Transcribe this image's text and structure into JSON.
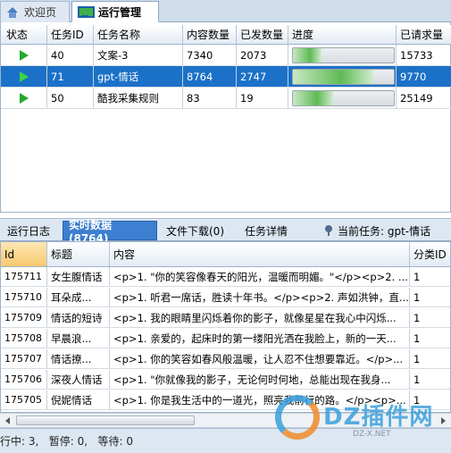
{
  "top_tabs": [
    {
      "label": "欢迎页",
      "icon": "home-icon",
      "active": false
    },
    {
      "label": "运行管理",
      "icon": "monitor-icon",
      "active": true
    }
  ],
  "task_grid": {
    "columns": [
      "状态",
      "任务ID",
      "任务名称",
      "内容数量",
      "已发数量",
      "进度",
      "已请求量"
    ],
    "rows": [
      {
        "status_icon": "play-icon",
        "id": "40",
        "name": "文案-3",
        "count": "7340",
        "sent": "2073",
        "progress": 0.28,
        "requested": "15733",
        "selected": false
      },
      {
        "status_icon": "play-icon",
        "id": "71",
        "name": "gpt-情话",
        "count": "8764",
        "sent": "2747",
        "progress": 0.8,
        "requested": "9770",
        "selected": true
      },
      {
        "status_icon": "play-icon",
        "id": "50",
        "name": "酷我采集规则",
        "count": "83",
        "sent": "19",
        "progress": 0.4,
        "requested": "25149",
        "selected": false
      }
    ]
  },
  "bottom_tabs": {
    "log": "运行日志",
    "realtime": "实时数据(8764)",
    "downloads": "文件下载(0)",
    "details": "任务详情",
    "current_task": "当前任务: gpt-情话"
  },
  "data_grid": {
    "columns": [
      "Id",
      "标题",
      "内容",
      "分类ID"
    ],
    "rows": [
      {
        "id": "175711",
        "title": "女生腹情话",
        "content": "<p>1. \"你的笑容像春天的阳光，温暖而明媚。\"</p><p>2. ...",
        "cat": "1"
      },
      {
        "id": "175710",
        "title": "耳朵成...",
        "content": "<p>1. 听君一席话，胜读十年书。</p><p>2. 声如洪钟，直...",
        "cat": "1"
      },
      {
        "id": "175709",
        "title": "情话的短诗",
        "content": "<p>1. 我的眼睛里闪烁着你的影子，就像星星在我心中闪烁...",
        "cat": "1"
      },
      {
        "id": "175708",
        "title": "早晨浪...",
        "content": "<p>1. 亲爱的，起床时的第一缕阳光洒在我脸上，新的一天...",
        "cat": "1"
      },
      {
        "id": "175707",
        "title": "情话撩...",
        "content": "<p>1. 你的笑容如春风般温暖，让人忍不住想要靠近。</p>...",
        "cat": "1"
      },
      {
        "id": "175706",
        "title": "深夜人情话",
        "content": "<p>1. \"你就像我的影子，无论何时何地，总能出现在我身...",
        "cat": "1"
      },
      {
        "id": "175705",
        "title": "倪妮情话",
        "content": "<p>1. 你是我生活中的一道光，照亮我前行的路。</p><p>...",
        "cat": "1"
      }
    ]
  },
  "status_bar": {
    "text": "行中: 3,   暂停: 0,   等待: 0"
  },
  "watermark": {
    "brand": "DZ插件网",
    "sub": "DZ-X.NET"
  }
}
